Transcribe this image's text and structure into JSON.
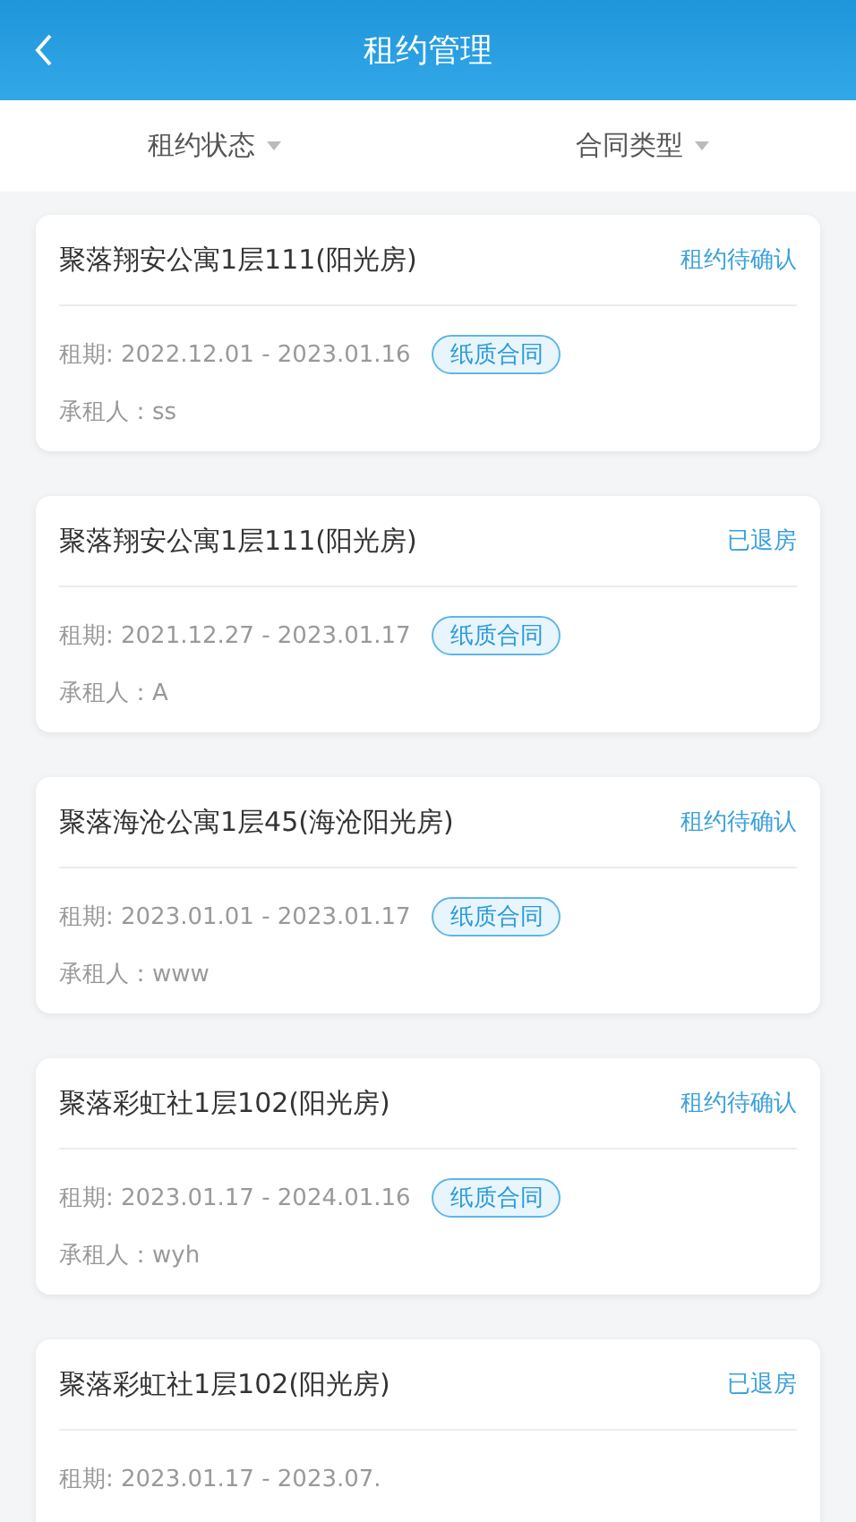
{
  "header": {
    "title": "租约管理"
  },
  "filters": [
    {
      "label": "租约状态"
    },
    {
      "label": "合同类型"
    }
  ],
  "leases": [
    {
      "property": "聚落翔安公寓1层111(阳光房)",
      "status": "租约待确认",
      "period": "租期: 2022.12.01 - 2023.01.16",
      "contract_type": "纸质合同",
      "tenant": "承租人：ss"
    },
    {
      "property": "聚落翔安公寓1层111(阳光房)",
      "status": "已退房",
      "period": "租期: 2021.12.27 - 2023.01.17",
      "contract_type": "纸质合同",
      "tenant": "承租人：A"
    },
    {
      "property": "聚落海沧公寓1层45(海沧阳光房)",
      "status": "租约待确认",
      "period": "租期: 2023.01.01 - 2023.01.17",
      "contract_type": "纸质合同",
      "tenant": "承租人：www"
    },
    {
      "property": "聚落彩虹社1层102(阳光房)",
      "status": "租约待确认",
      "period": "租期: 2023.01.17 - 2024.01.16",
      "contract_type": "纸质合同",
      "tenant": "承租人：wyh"
    },
    {
      "property": "聚落彩虹社1层102(阳光房)",
      "status": "已退房",
      "period": "租期: 2023.01.17 - 2023.07."
    }
  ]
}
